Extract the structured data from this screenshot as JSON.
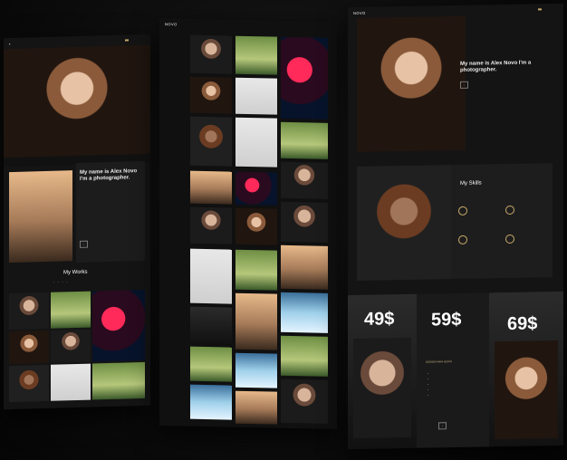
{
  "panel1": {
    "hero_headline": "My name is Alex Novo I'm a photographer.",
    "works_heading": "My Works"
  },
  "panel2": {
    "logo": "NOVO"
  },
  "panel3": {
    "logo": "NOVO",
    "hero_headline": "My name is Alex Novo I'm a photographer.",
    "skills_heading": "My Skills",
    "prices": [
      "49$",
      "59$",
      "69$"
    ],
    "pricing_heading": "SESSION PARA VESTIR"
  }
}
